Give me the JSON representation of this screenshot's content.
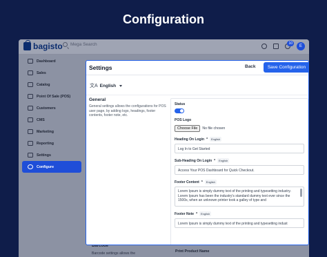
{
  "hero": {
    "title": "Configuration"
  },
  "topbar": {
    "logo": "bagisto",
    "search_placeholder": "Mega Search",
    "notification_count": "10",
    "avatar_initial": "E"
  },
  "sidebar": {
    "items": [
      {
        "label": "Dashboard",
        "icon": "dashboard-icon"
      },
      {
        "label": "Sales",
        "icon": "sales-icon"
      },
      {
        "label": "Catalog",
        "icon": "catalog-icon"
      },
      {
        "label": "Point Of Sale (POS)",
        "icon": "pos-icon"
      },
      {
        "label": "Customers",
        "icon": "customers-icon"
      },
      {
        "label": "CMS",
        "icon": "cms-icon"
      },
      {
        "label": "Marketing",
        "icon": "marketing-icon"
      },
      {
        "label": "Reporting",
        "icon": "reporting-icon"
      },
      {
        "label": "Settings",
        "icon": "settings-icon"
      },
      {
        "label": "Configure",
        "icon": "configure-icon",
        "active": true
      }
    ]
  },
  "background_section": {
    "title": "Barcode",
    "desc": "Barcode settings allows the",
    "right_label": "Print Product Name"
  },
  "modal": {
    "title": "Settings",
    "back_label": "Back",
    "save_label": "Save Configuration",
    "language": "English",
    "group": {
      "title": "General",
      "description": "General settings allows the configurations for POS user page, by adding logo, headings, footer contents, footer note, etc."
    },
    "fields": {
      "status_label": "Status",
      "logo_label": "POS Logo",
      "file_button": "Choose File",
      "file_status": "No file chosen",
      "heading_label": "Heading On Login",
      "heading_value": "Log In to Get Started",
      "subheading_label": "Sub-Heading On Login",
      "subheading_value": "Access Your POS Dashboard for Quick Checkout.",
      "footer_content_label": "Footer Content",
      "footer_content_value": "Lorem Ipsum is simply dummy text of the printing and typesetting industry. Lorem Ipsum has been the industry's standard dummy text ever since the 1500s, when an unknown printer took a galley of type and",
      "footer_note_label": "Footer Note",
      "footer_note_value": "Lorem Ipsum is simply dummy text of the printing and typesetting indust",
      "locale_tag": "English",
      "required_mark": "*"
    }
  },
  "colors": {
    "accent": "#2563eb",
    "page_bg": "#0f1d4a"
  }
}
